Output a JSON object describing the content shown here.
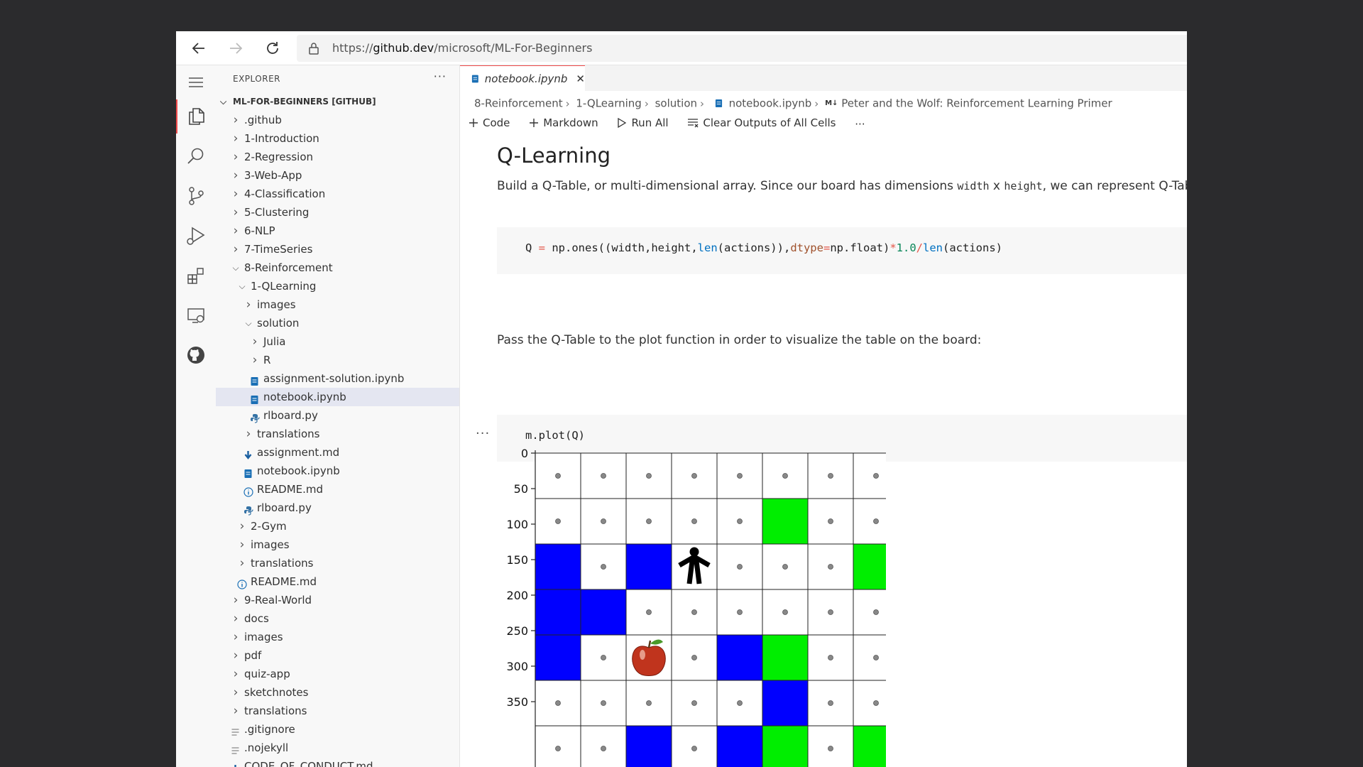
{
  "browser": {
    "url_prefix": "https://",
    "url_host": "github.dev",
    "url_path": "/microsoft/ML-For-Beginners"
  },
  "activity_bar": {
    "icons": [
      "menu-icon",
      "files-icon",
      "search-icon",
      "source-control-icon",
      "run-debug-icon",
      "extensions-icon",
      "remote-explorer-icon",
      "github-icon"
    ]
  },
  "explorer": {
    "title": "EXPLORER",
    "more": "···",
    "root": "ML-FOR-BEGINNERS [GITHUB]",
    "items": [
      {
        "label": ".github",
        "depth": 0,
        "type": "folder",
        "open": false
      },
      {
        "label": "1-Introduction",
        "depth": 0,
        "type": "folder",
        "open": false
      },
      {
        "label": "2-Regression",
        "depth": 0,
        "type": "folder",
        "open": false
      },
      {
        "label": "3-Web-App",
        "depth": 0,
        "type": "folder",
        "open": false
      },
      {
        "label": "4-Classification",
        "depth": 0,
        "type": "folder",
        "open": false
      },
      {
        "label": "5-Clustering",
        "depth": 0,
        "type": "folder",
        "open": false
      },
      {
        "label": "6-NLP",
        "depth": 0,
        "type": "folder",
        "open": false
      },
      {
        "label": "7-TimeSeries",
        "depth": 0,
        "type": "folder",
        "open": false
      },
      {
        "label": "8-Reinforcement",
        "depth": 0,
        "type": "folder",
        "open": true
      },
      {
        "label": "1-QLearning",
        "depth": 1,
        "type": "folder",
        "open": true
      },
      {
        "label": "images",
        "depth": 2,
        "type": "folder",
        "open": false
      },
      {
        "label": "solution",
        "depth": 2,
        "type": "folder",
        "open": true
      },
      {
        "label": "Julia",
        "depth": 3,
        "type": "folder",
        "open": false
      },
      {
        "label": "R",
        "depth": 3,
        "type": "folder",
        "open": false
      },
      {
        "label": "assignment-solution.ipynb",
        "depth": 3,
        "type": "notebook"
      },
      {
        "label": "notebook.ipynb",
        "depth": 3,
        "type": "notebook",
        "selected": true
      },
      {
        "label": "rlboard.py",
        "depth": 3,
        "type": "python"
      },
      {
        "label": "translations",
        "depth": 2,
        "type": "folder",
        "open": false
      },
      {
        "label": "assignment.md",
        "depth": 2,
        "type": "markdown"
      },
      {
        "label": "notebook.ipynb",
        "depth": 2,
        "type": "notebook"
      },
      {
        "label": "README.md",
        "depth": 2,
        "type": "info"
      },
      {
        "label": "rlboard.py",
        "depth": 2,
        "type": "python"
      },
      {
        "label": "2-Gym",
        "depth": 1,
        "type": "folder",
        "open": false
      },
      {
        "label": "images",
        "depth": 1,
        "type": "folder",
        "open": false
      },
      {
        "label": "translations",
        "depth": 1,
        "type": "folder",
        "open": false
      },
      {
        "label": "README.md",
        "depth": 1,
        "type": "info"
      },
      {
        "label": "9-Real-World",
        "depth": 0,
        "type": "folder",
        "open": false
      },
      {
        "label": "docs",
        "depth": 0,
        "type": "folder",
        "open": false
      },
      {
        "label": "images",
        "depth": 0,
        "type": "folder",
        "open": false
      },
      {
        "label": "pdf",
        "depth": 0,
        "type": "folder",
        "open": false
      },
      {
        "label": "quiz-app",
        "depth": 0,
        "type": "folder",
        "open": false
      },
      {
        "label": "sketchnotes",
        "depth": 0,
        "type": "folder",
        "open": false
      },
      {
        "label": "translations",
        "depth": 0,
        "type": "folder",
        "open": false
      },
      {
        "label": ".gitignore",
        "depth": 0,
        "type": "text"
      },
      {
        "label": ".nojekyll",
        "depth": 0,
        "type": "text"
      },
      {
        "label": "CODE_OF_CONDUCT.md",
        "depth": 0,
        "type": "markdown"
      }
    ]
  },
  "editor": {
    "tab": {
      "label": "notebook.ipynb",
      "close": "✕"
    },
    "breadcrumbs": [
      "8-Reinforcement",
      "1-QLearning",
      "solution",
      "notebook.ipynb"
    ],
    "breadcrumb_md_badge": "M↓",
    "breadcrumb_last": "Peter and the Wolf: Reinforcement Learning Primer",
    "toolbar": {
      "code": "Code",
      "markdown": "Markdown",
      "run_all": "Run All",
      "clear": "Clear Outputs of All Cells",
      "more": "···"
    }
  },
  "notebook": {
    "heading": "Q-Learning",
    "para1_a": "Build a Q-Table, or multi-dimensional array. Since our board has dimensions ",
    "para1_code1": "width",
    "para1_x": " x ",
    "para1_code2": "height",
    "para1_b": ", we can represent Q-Table by a numpy",
    "cell1": {
      "t1": "Q ",
      "t2": "=",
      "t3": " np.ones((width,height,",
      "t4": "len",
      "t5": "(actions)),",
      "t6": "dtype",
      "t7": "=",
      "t8": "np.float)",
      "t9": "*",
      "t10": "1.0",
      "t11": "/",
      "t12": "len",
      "t13": "(actions)"
    },
    "para2": "Pass the Q-Table to the plot function in order to visualize the table on the board:",
    "cell2": "m.plot(Q)",
    "output_more": "···"
  },
  "board": {
    "y_ticks": [
      "0",
      "50",
      "100",
      "150",
      "200",
      "250",
      "300",
      "350"
    ],
    "colors": {
      "water": "#0000ff",
      "grass": "#00ee00",
      "empty": "#ffffff"
    },
    "grid": [
      [
        "e",
        "e",
        "e",
        "e",
        "e",
        "e",
        "e",
        "e"
      ],
      [
        "e",
        "e",
        "e",
        "e",
        "e",
        "g",
        "e",
        "e"
      ],
      [
        "w",
        "e",
        "w",
        "p",
        "e",
        "e",
        "e",
        "g"
      ],
      [
        "w",
        "w",
        "e",
        "e",
        "e",
        "e",
        "e",
        "e"
      ],
      [
        "w",
        "e",
        "a",
        "e",
        "w",
        "g",
        "e",
        "e"
      ],
      [
        "e",
        "e",
        "e",
        "e",
        "e",
        "w",
        "e",
        "e"
      ],
      [
        "e",
        "e",
        "w",
        "e",
        "w",
        "g",
        "e",
        "g"
      ]
    ],
    "legend": {
      "w": "water",
      "g": "grass",
      "e": "empty",
      "p": "person-icon",
      "a": "apple-icon"
    }
  }
}
